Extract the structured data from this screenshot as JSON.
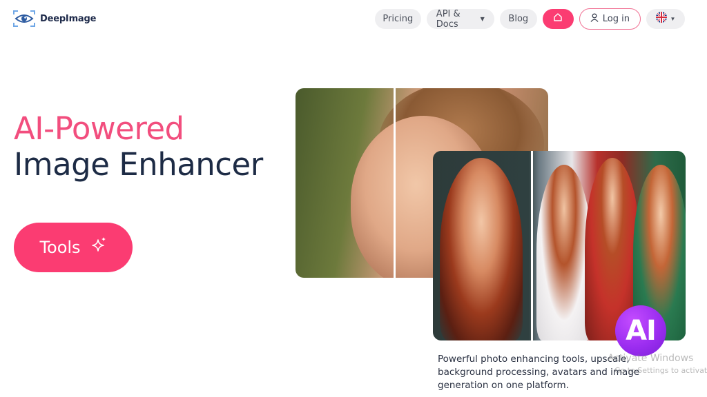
{
  "header": {
    "logo_text": "DeepImage",
    "logo_icon": "eye-scan-icon",
    "nav": {
      "pricing_label": "Pricing",
      "api_docs_label": "API & Docs",
      "blog_label": "Blog",
      "home_icon": "home-icon",
      "login_label": "Log in",
      "user_icon": "user-icon",
      "language_icon": "uk-flag-icon"
    }
  },
  "hero": {
    "title_line1": "AI-Powered",
    "title_line2": "Image Enhancer",
    "tools_button_label": "Tools",
    "tools_icon": "sparkle-icon"
  },
  "showcase": {
    "ai_badge_text": "AI",
    "description": "Powerful photo enhancing tools, upscale, background processing, avatars and image generation on one platform."
  },
  "os_overlay": {
    "line1": "Activate Windows",
    "line2": "Go to Settings to activate W"
  },
  "colors": {
    "accent": "#fb3c72",
    "title_pink": "#f24e7e",
    "title_dark": "#1d2b45",
    "ai_badge": "#9b2df0"
  }
}
